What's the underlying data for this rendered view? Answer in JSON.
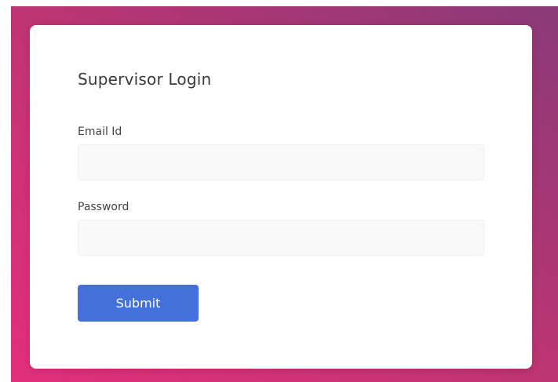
{
  "login": {
    "title": "Supervisor Login",
    "email_label": "Email Id",
    "email_value": "",
    "password_label": "Password",
    "password_value": "",
    "submit_label": "Submit"
  },
  "colors": {
    "primary_button": "#4471d9",
    "background_gradient_start": "#e2307a",
    "background_gradient_end": "#8a3a78",
    "card_background": "#ffffff",
    "input_background": "#f9f9f9"
  }
}
